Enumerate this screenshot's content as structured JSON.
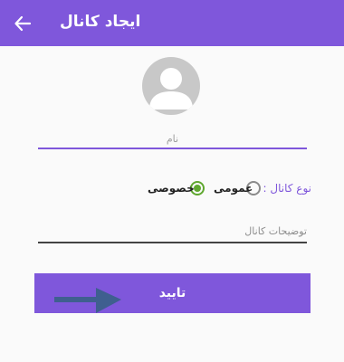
{
  "appbar": {
    "title": "ایجاد کانال",
    "back_icon": "arrow-back-icon",
    "color": "#7f57db"
  },
  "avatar": {
    "icon": "person-icon"
  },
  "form": {
    "name_placeholder": "نام",
    "channel_type_label": "نوع کانال :",
    "public_label": "عمومی",
    "private_label": "خصوصی",
    "selected_type": "private",
    "description_placeholder": "توضیحات کانال"
  },
  "confirm": {
    "label": "تایید"
  },
  "annotation": {
    "icon": "pointer-arrow-icon",
    "color": "#3f5f8f"
  }
}
